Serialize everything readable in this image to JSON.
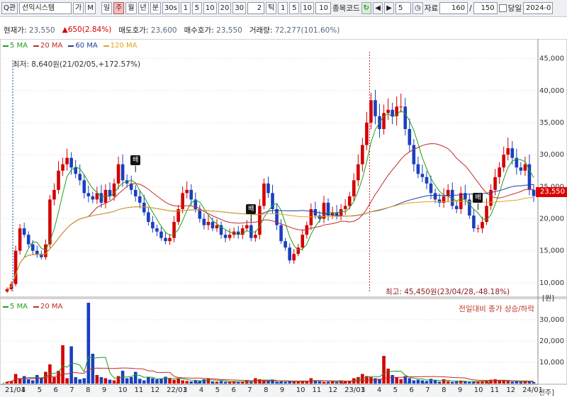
{
  "toolbar": {
    "stock_code_prefix": "Q관",
    "stock_name": "선익시스템",
    "ga_label": "가",
    "m_label": "M",
    "periods": [
      "일",
      "주",
      "월",
      "년"
    ],
    "active_period": "주",
    "minute_label": "분",
    "seconds_label": "30s",
    "intervals": [
      "1",
      "5",
      "10",
      "20",
      "30"
    ],
    "tick_value": "2",
    "tick_label": "틱",
    "tick_intervals": [
      "1",
      "5",
      "10"
    ],
    "tick_input": "10",
    "stock_code_label": "종목코드",
    "step_value": "5",
    "data_label": "자료",
    "data_count": "160",
    "page_sep": "/",
    "page_total": "150",
    "today_label": "당일",
    "date_value": "2024-0"
  },
  "quote": {
    "current_label": "현재가:",
    "current_value": "23,550",
    "change_value": "▲650(2.84%)",
    "ask_label": "매도호가:",
    "ask_value": "23,600",
    "bid_label": "매수호가:",
    "bid_value": "23,550",
    "volume_label": "거래량:",
    "volume_value": "72,277(101.60%)"
  },
  "legend_price": [
    {
      "label": "5 MA",
      "color": "#1e9e1e"
    },
    {
      "label": "20 MA",
      "color": "#c62828"
    },
    {
      "label": "60 MA",
      "color": "#1f3fa0"
    },
    {
      "label": "120 MA",
      "color": "#e6a21a"
    }
  ],
  "legend_volume": [
    {
      "label": "5 MA",
      "color": "#1e9e1e"
    },
    {
      "label": "20 MA",
      "color": "#c62828"
    }
  ],
  "annotations": {
    "low": "최저: 8,640원(21/02/05,+172.57%)",
    "high": "최고: 45,450원(23/04/28,-48.18%)",
    "volume_title": "전일대비 종가 상승/하락",
    "price_unit": "[원]",
    "volume_unit": "[천주]",
    "marker_label": "배"
  },
  "colors": {
    "up": "#d40000",
    "down": "#1a3fbf",
    "last_price_bg": "#e00000"
  },
  "chart_data": [
    {
      "type": "candlestick",
      "title": "",
      "x_tick_labels": [
        "21/01",
        "4",
        "5",
        "6",
        "7",
        "8",
        "9",
        "10",
        "11",
        "12",
        "22/01",
        "3",
        "4",
        "5",
        "6",
        "7",
        "8",
        "9",
        "10",
        "11",
        "12",
        "23/01",
        "3",
        "4",
        "5",
        "6",
        "7",
        "8",
        "9",
        "10",
        "11",
        "12",
        "24/01"
      ],
      "y_tick_labels": [
        "10,000",
        "15,000",
        "20,000",
        "25,000",
        "30,000",
        "35,000",
        "40,000",
        "45,000"
      ],
      "ylim": [
        8000,
        46500
      ],
      "last_price": "23,550",
      "close_series": [
        9000,
        9800,
        15000,
        18500,
        17500,
        16000,
        15000,
        14500,
        14000,
        16000,
        23000,
        24500,
        27500,
        28500,
        29500,
        28000,
        27000,
        26000,
        24000,
        23500,
        23000,
        24000,
        22500,
        24500,
        23500,
        25500,
        28500,
        26000,
        25500,
        24500,
        23500,
        22500,
        21000,
        19500,
        18500,
        18000,
        17000,
        16500,
        17000,
        19500,
        21500,
        24000,
        24500,
        23000,
        21500,
        20000,
        19000,
        19500,
        18500,
        19000,
        17500,
        17000,
        17500,
        18000,
        17500,
        18500,
        19000,
        17000,
        17500,
        22000,
        25500,
        24000,
        21500,
        19000,
        16500,
        15500,
        13500,
        14500,
        15500,
        17500,
        19000,
        21500,
        20500,
        20000,
        22500,
        20500,
        21000,
        20500,
        21500,
        22000,
        23500,
        26000,
        28500,
        31500,
        35000,
        38500,
        36000,
        34000,
        36500,
        37000,
        36000,
        37500,
        37500,
        34000,
        31500,
        28500,
        27000,
        26500,
        25500,
        24000,
        23000,
        22500,
        23500,
        24500,
        22000,
        21500,
        24000,
        23000,
        20500,
        18500,
        18500,
        19500,
        22000,
        24500,
        26500,
        28000,
        30000,
        31000,
        29500,
        28000,
        27500,
        28500,
        24500,
        23550
      ],
      "markers_at_index": [
        30,
        57,
        110
      ],
      "series": [
        {
          "name": "5 MA",
          "source": "close"
        },
        {
          "name": "20 MA",
          "source": "close"
        },
        {
          "name": "60 MA",
          "source": "close"
        },
        {
          "name": "120 MA",
          "source": "close"
        }
      ]
    },
    {
      "type": "bar",
      "title": "",
      "y_tick_labels": [
        "10,000",
        "20,000",
        "30,000"
      ],
      "ylim": [
        0,
        38000
      ],
      "volume_series": [
        800,
        1200,
        4500,
        2500,
        3500,
        2000,
        1500,
        4000,
        2500,
        5500,
        9000,
        3000,
        6000,
        18000,
        2500,
        17500,
        3000,
        2000,
        2500,
        38000,
        14000,
        4000,
        3000,
        2500,
        1800,
        1500,
        3500,
        6000,
        2500,
        3000,
        5500,
        2200,
        1500,
        3000,
        2500,
        2000,
        2200,
        3200,
        2500,
        1800,
        2500,
        1500,
        1200,
        1000,
        1500,
        1300,
        2000,
        2500,
        1000,
        900,
        1200,
        800,
        900,
        1100,
        700,
        800,
        1500,
        800,
        2500,
        2000,
        1500,
        1200,
        1800,
        900,
        1000,
        800,
        1200,
        900,
        800,
        1300,
        1000,
        2500,
        1500,
        1000,
        800,
        900,
        1200,
        700,
        1500,
        1000,
        1300,
        2500,
        3000,
        4500,
        3500,
        3000,
        2500,
        2200,
        13000,
        7000,
        4000,
        3000,
        2000,
        3500,
        2500,
        1500,
        1800,
        1500,
        1200,
        2200,
        1500,
        900,
        2000,
        1100,
        800,
        1000,
        1400,
        1000,
        700,
        900,
        1000,
        1200,
        1500,
        1800,
        2000,
        1500,
        1200,
        1100,
        900,
        1000,
        800,
        1300,
        900,
        700
      ],
      "series": [
        {
          "name": "5 MA",
          "source": "volume"
        },
        {
          "name": "20 MA",
          "source": "volume"
        }
      ]
    }
  ]
}
